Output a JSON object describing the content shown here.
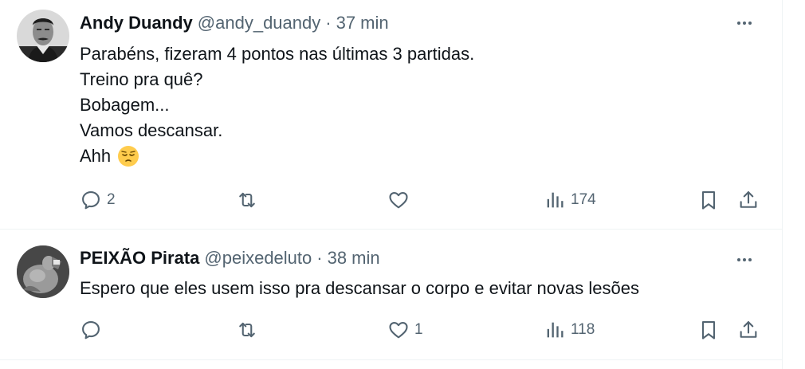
{
  "tweets": [
    {
      "author_name": "Andy Duandy",
      "handle": "@andy_duandy",
      "separator": "·",
      "time": "37 min",
      "text_lines": [
        "Parabéns, fizeram 4 pontos nas últimas 3 partidas.",
        "Treino pra quê?",
        "Bobagem...",
        "Vamos descansar.",
        "Ahh"
      ],
      "emoji": "pensive-face",
      "reply_count": "2",
      "repost_count": "",
      "like_count": "",
      "view_count": "174"
    },
    {
      "author_name": "PEIXÃO Pirata",
      "handle": "@peixedeluto",
      "separator": "·",
      "time": "38 min",
      "text_lines": [
        "Espero que eles usem isso pra descansar o corpo e evitar novas lesões"
      ],
      "reply_count": "",
      "repost_count": "",
      "like_count": "1",
      "view_count": "118"
    }
  ],
  "icons": {
    "more": "more-horizontal-icon",
    "reply": "reply-bubble-icon",
    "repost": "repost-arrows-icon",
    "like": "heart-icon",
    "views": "analytics-bars-icon",
    "bookmark": "bookmark-icon",
    "share": "share-upload-icon"
  },
  "colors": {
    "text_primary": "#0f1419",
    "text_secondary": "#536471",
    "divider": "#eff3f4"
  }
}
